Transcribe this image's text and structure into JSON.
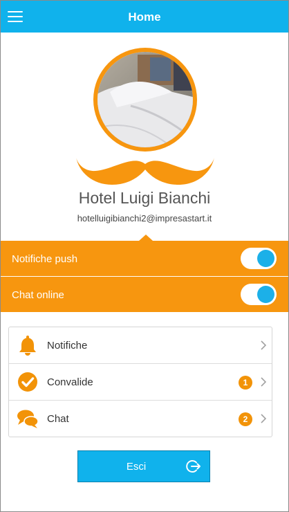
{
  "header": {
    "title": "Home",
    "menu_icon": "hamburger-menu-icon"
  },
  "profile": {
    "avatar": "hotel-bed-photo",
    "logo": "mustache-logo",
    "name": "Hotel Luigi Bianchi",
    "email": "hotelluigibianchi2@impresastart.it"
  },
  "toggles": [
    {
      "label": "Notifiche push",
      "on": true
    },
    {
      "label": "Chat online",
      "on": true
    }
  ],
  "menu": [
    {
      "label": "Notifiche",
      "icon": "bell-icon",
      "badge": null
    },
    {
      "label": "Convalide",
      "icon": "check-circle-icon",
      "badge": "1"
    },
    {
      "label": "Chat",
      "icon": "chat-bubbles-icon",
      "badge": "2"
    }
  ],
  "logout": {
    "label": "Esci",
    "icon": "logout-icon"
  },
  "colors": {
    "header": "#10b2ec",
    "accent": "#f7960f",
    "toggle_knob": "#1cb0e8"
  }
}
